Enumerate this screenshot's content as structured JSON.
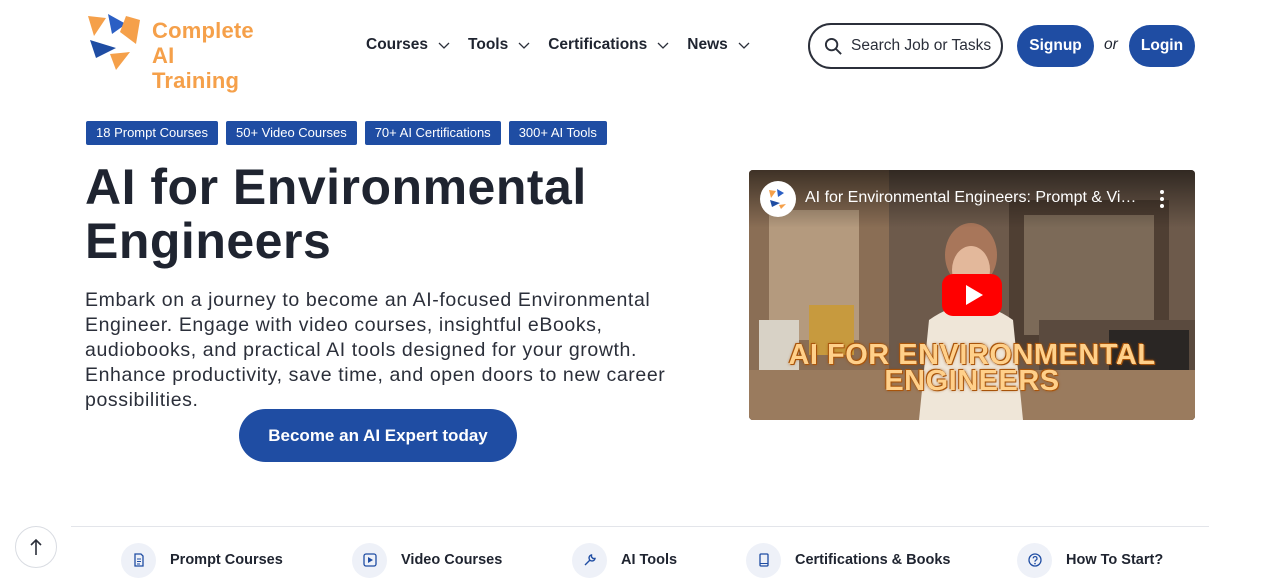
{
  "brand": {
    "name_line1": "Complete",
    "name_line2": "AI Training",
    "logo_icon": "triangle-logo-icon",
    "accent_color": "#f5a04a",
    "primary_color": "#1f4da3"
  },
  "nav": {
    "items": [
      {
        "label": "Courses",
        "icon": "chevron-down-icon"
      },
      {
        "label": "Tools",
        "icon": "chevron-down-icon"
      },
      {
        "label": "Certifications",
        "icon": "chevron-down-icon"
      },
      {
        "label": "News",
        "icon": "chevron-down-icon"
      }
    ]
  },
  "search": {
    "placeholder": "Search Job or Tasks",
    "icon": "search-icon"
  },
  "auth": {
    "signup_label": "Signup",
    "or_label": "or",
    "login_label": "Login"
  },
  "badges": [
    "18 Prompt Courses",
    "50+ Video Courses",
    "70+ AI Certifications",
    "300+ AI Tools"
  ],
  "hero": {
    "title_line1": "AI for Environmental",
    "title_line2": "Engineers",
    "description": "Embark on a journey to become an AI-focused Environmental Engineer. Engage with video courses, insightful eBooks, audiobooks, and practical AI tools designed for your growth. Enhance productivity, save time, and open doors to new career possibilities.",
    "cta_label": "Become an AI Expert today"
  },
  "video": {
    "title": "AI for Environmental Engineers: Prompt & Video Courses",
    "overlay_line1": "AI FOR ENVIRONMENTAL",
    "overlay_line2": "ENGINEERS",
    "play_icon": "play-icon",
    "menu_icon": "more-vert-icon"
  },
  "bottom_nav": [
    {
      "label": "Prompt Courses",
      "icon": "document-icon"
    },
    {
      "label": "Video Courses",
      "icon": "play-square-icon"
    },
    {
      "label": "AI Tools",
      "icon": "wrench-icon"
    },
    {
      "label": "Certifications & Books",
      "icon": "book-icon"
    },
    {
      "label": "How To Start?",
      "icon": "question-circle-icon"
    }
  ],
  "scroll_top_icon": "arrow-up-icon"
}
